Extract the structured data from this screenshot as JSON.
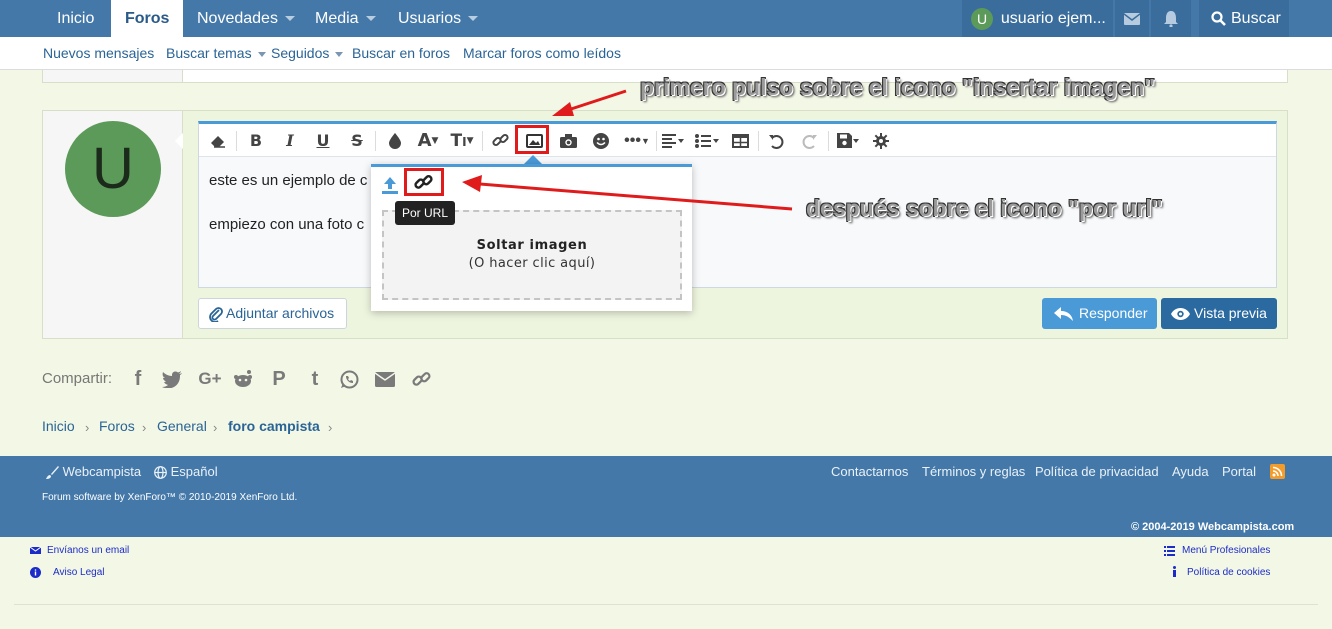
{
  "topnav": {
    "tabs": [
      {
        "label": "Inicio"
      },
      {
        "label": "Foros",
        "active": true
      },
      {
        "label": "Novedades"
      },
      {
        "label": "Media"
      },
      {
        "label": "Usuarios"
      }
    ],
    "user": {
      "initial": "U",
      "name": "usuario ejem..."
    },
    "search_label": "Buscar"
  },
  "subnav": {
    "items": [
      "Nuevos mensajes",
      "Buscar temas",
      "Seguidos",
      "Buscar en foros",
      "Marcar foros como leídos"
    ]
  },
  "reply": {
    "avatar_initial": "U",
    "editor_lines": [
      "este es un ejemplo de c",
      "empiezo con una foto c"
    ],
    "attach_label": "Adjuntar archivos",
    "reply_label": "Responder",
    "preview_label": "Vista previa"
  },
  "popup": {
    "tooltip": "Por URL",
    "drop_title": "Soltar imagen",
    "drop_subtitle": "(O hacer clic aquí)"
  },
  "annotations": {
    "first": "primero pulso sobre el icono \"insertar imagen\"",
    "second": "después sobre el icono \"por url\""
  },
  "share": {
    "label": "Compartir:"
  },
  "breadcrumb": [
    "Inicio",
    "Foros",
    "General",
    "foro campista"
  ],
  "footer": {
    "style_name": "Webcampista",
    "language": "Español",
    "links": [
      "Contactarnos",
      "Términos y reglas",
      "Política de privacidad",
      "Ayuda",
      "Portal"
    ],
    "software": "Forum software by XenForo™ © 2010-2019 XenForo Ltd.",
    "copyright": "© 2004-2019 Webcampista.com"
  },
  "bottom": {
    "left": [
      "Envíanos un email",
      "Aviso Legal"
    ],
    "right": [
      "Menú Profesionales",
      "Política de cookies"
    ]
  },
  "colors": {
    "nav": "#4378a9",
    "accent": "#4a9ad8",
    "highlight": "#e01b1b",
    "arrow": "#e01b1b"
  }
}
